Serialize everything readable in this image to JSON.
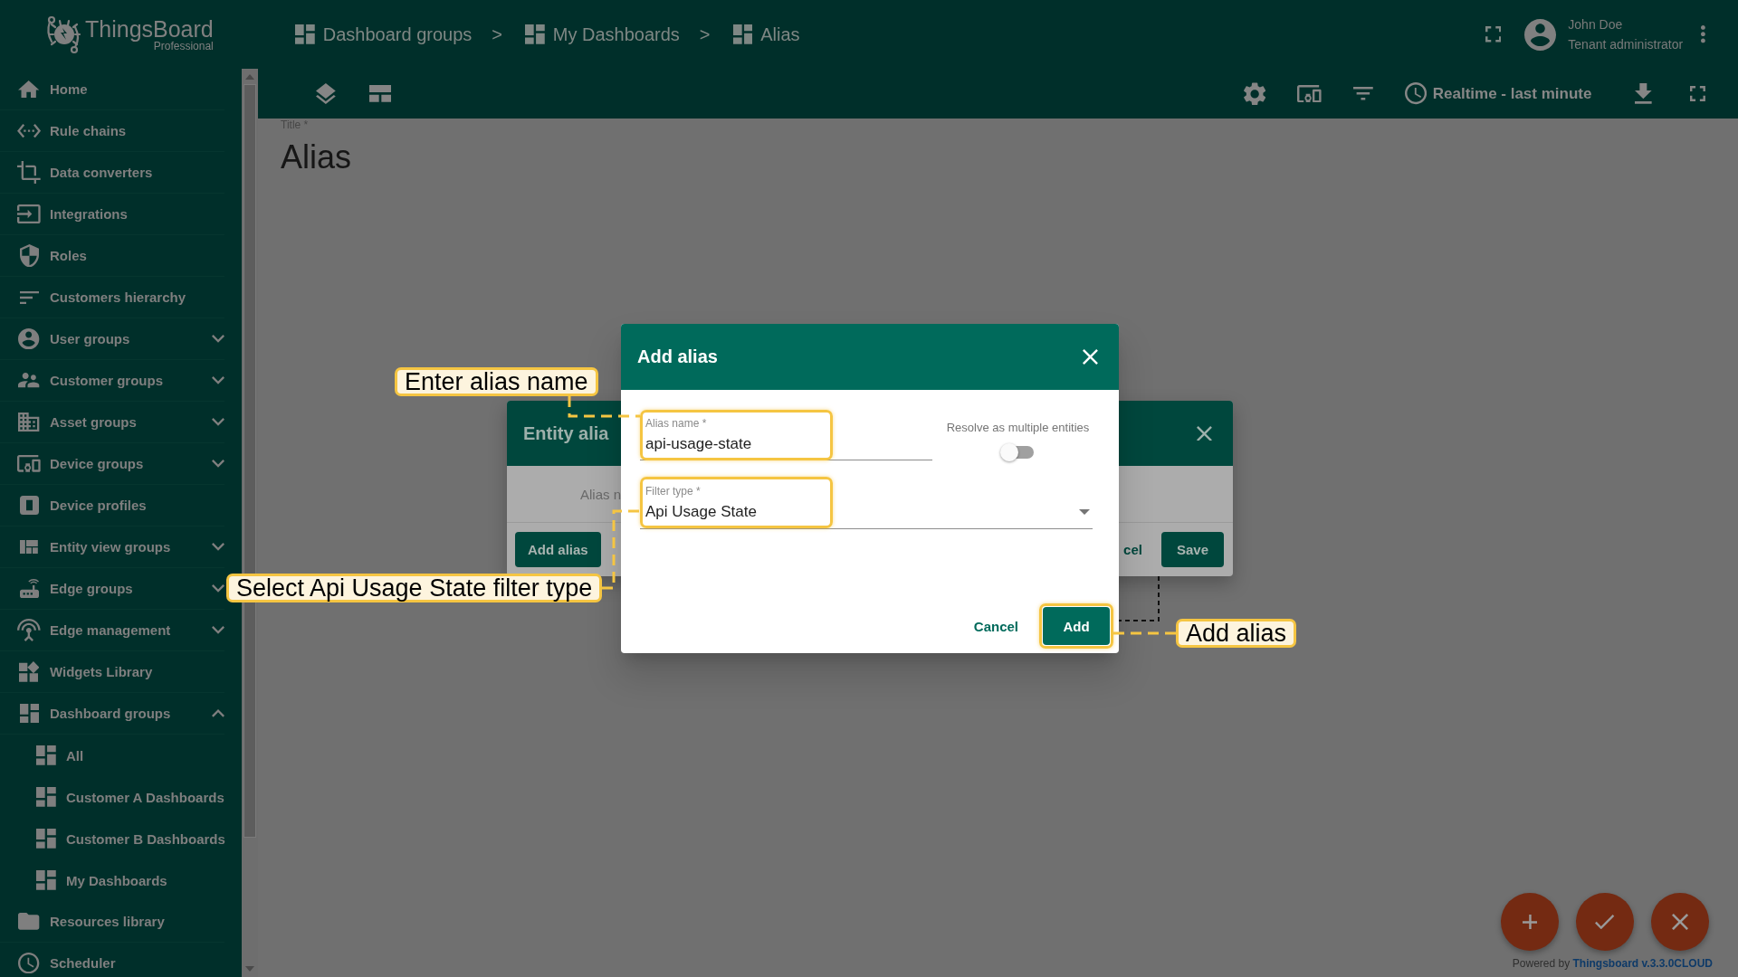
{
  "header": {
    "logo": {
      "name": "ThingsBoard",
      "edition": "Professional"
    },
    "breadcrumbs": [
      {
        "label": "Dashboard groups",
        "separator": ">"
      },
      {
        "label": "My Dashboards",
        "separator": ">"
      },
      {
        "label": "Alias"
      }
    ],
    "user": {
      "name": "John Doe",
      "role": "Tenant administrator"
    }
  },
  "toolbar": {
    "timewindow": "Realtime - last minute"
  },
  "sidebar": {
    "items": [
      {
        "label": "Home"
      },
      {
        "label": "Rule chains"
      },
      {
        "label": "Data converters"
      },
      {
        "label": "Integrations"
      },
      {
        "label": "Roles"
      },
      {
        "label": "Customers hierarchy"
      },
      {
        "label": "User groups",
        "expanded": false
      },
      {
        "label": "Customer groups",
        "expanded": false
      },
      {
        "label": "Asset groups",
        "expanded": false
      },
      {
        "label": "Device groups",
        "expanded": false
      },
      {
        "label": "Device profiles"
      },
      {
        "label": "Entity view groups",
        "expanded": false
      },
      {
        "label": "Edge groups",
        "expanded": false
      },
      {
        "label": "Edge management",
        "expanded": false
      },
      {
        "label": "Widgets Library"
      },
      {
        "label": "Dashboard groups",
        "expanded": true,
        "children": [
          {
            "label": "All"
          },
          {
            "label": "Customer A Dashboards"
          },
          {
            "label": "Customer B Dashboards"
          },
          {
            "label": "My Dashboards"
          }
        ]
      },
      {
        "label": "Resources library"
      },
      {
        "label": "Scheduler"
      }
    ]
  },
  "page": {
    "title_label": "Title *",
    "title": "Alias"
  },
  "entity_aliases_dialog": {
    "title": "Entity alia",
    "column_header": "Alias n",
    "add_button": "Add alias",
    "cancel_button": "cel",
    "save_button": "Save"
  },
  "add_alias_dialog": {
    "title": "Add alias",
    "alias_name": {
      "label": "Alias name *",
      "value": "api-usage-state"
    },
    "resolve_multiple": {
      "label": "Resolve as multiple entities",
      "on": false
    },
    "filter_type": {
      "label": "Filter type *",
      "value": "Api Usage State"
    },
    "buttons": {
      "cancel": "Cancel",
      "add": "Add"
    }
  },
  "callouts": [
    {
      "text": "Enter alias name"
    },
    {
      "text": "Select Api Usage State filter type"
    },
    {
      "text": "Add alias"
    }
  ],
  "footer": {
    "prefix": "Powered by",
    "link": "Thingsboard v.3.3.0CLOUD"
  }
}
